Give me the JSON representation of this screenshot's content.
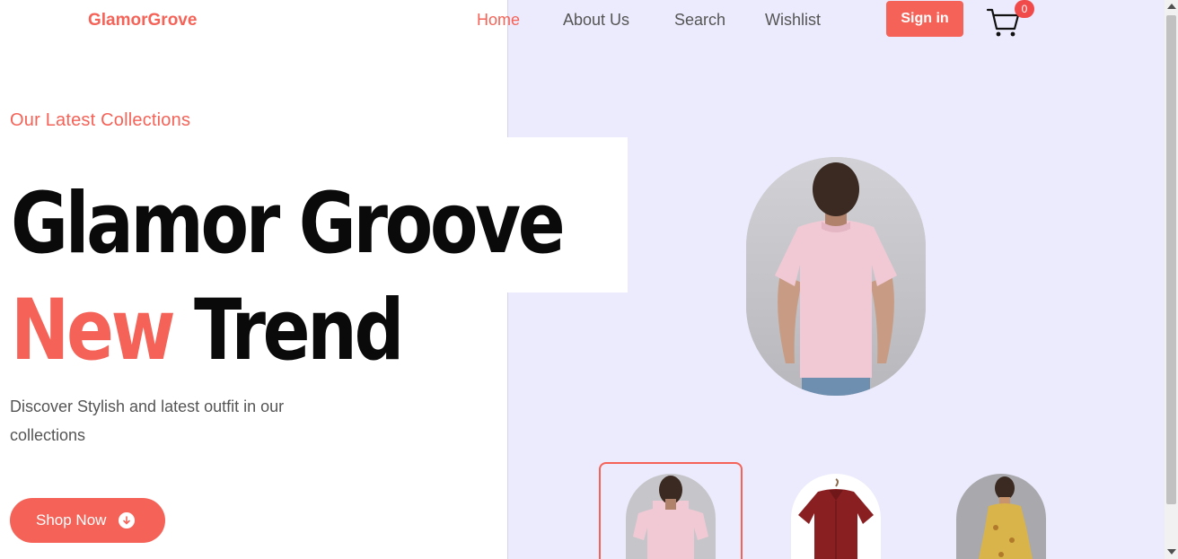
{
  "colors": {
    "accent": "#f56358",
    "panel": "#ebebfd",
    "text_dark": "#0a0a0a",
    "text_muted": "#555555"
  },
  "navbar": {
    "logo": "GlamorGrove",
    "links": [
      {
        "label": "Home",
        "active": true
      },
      {
        "label": "About Us",
        "active": false
      },
      {
        "label": "Search",
        "active": false
      },
      {
        "label": "Wishlist",
        "active": false
      }
    ],
    "signin_label": "Sign in",
    "cart_icon": "shopping-cart-icon",
    "cart_count": "0"
  },
  "hero": {
    "subtitle": "Our Latest Collections",
    "title_line1": "Glamor Groove",
    "title_line2_accent": "New",
    "title_line2_rest": "Trend",
    "description": "Discover Stylish and latest outfit in our collections",
    "cta_label": "Shop Now",
    "cta_icon": "arrow-down-circle-icon"
  },
  "gallery": {
    "main_image": "pink-polo-shirt-back-view",
    "thumbnails": [
      {
        "image": "pink-polo-shirt-back-view",
        "selected": true
      },
      {
        "image": "red-shirt-on-hanger",
        "selected": false
      },
      {
        "image": "yellow-floral-dress",
        "selected": false
      }
    ]
  }
}
